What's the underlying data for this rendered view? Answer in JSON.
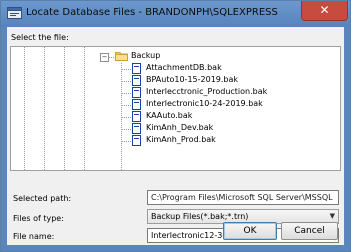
{
  "window": {
    "title": "Locate Database Files - BRANDONPH\\SQLEXPRESS",
    "close_glyph": "✕"
  },
  "tree": {
    "label": "Select the file:",
    "folder": "Backup",
    "files": [
      "AttachmentDB.bak",
      "BPAuto10-15-2019.bak",
      "Interlecctronic_Production.bak",
      "Interlectronic10-24-2019.bak",
      "KAAuto.bak",
      "KimAnh_Dev.bak",
      "KimAnh_Prod.bak"
    ]
  },
  "form": {
    "selected_path_label": "Selected path:",
    "selected_path_value": "C:\\Program Files\\Microsoft SQL Server\\MSSQL",
    "files_of_type_label": "Files of type:",
    "files_of_type_value": "Backup Files(*.bak;*.trn)",
    "file_name_label": "File name:",
    "file_name_value": "Interlectronic12-3-2019.bak"
  },
  "buttons": {
    "ok": "OK",
    "cancel": "Cancel"
  },
  "colors": {
    "titlebar": "#5b86bd",
    "close": "#c74b3f",
    "dialog": "#f0f0f0"
  }
}
